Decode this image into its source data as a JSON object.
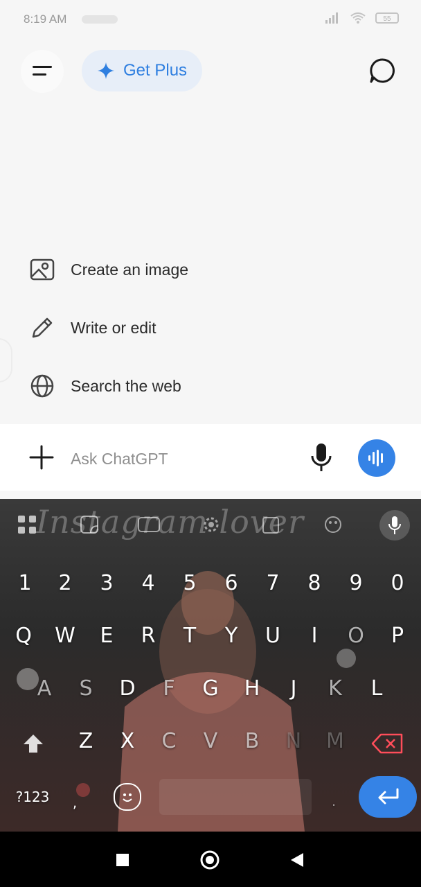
{
  "status_bar": {
    "time": "8:19 AM",
    "battery": "55"
  },
  "header": {
    "get_plus_label": "Get Plus",
    "menu_icon": "menu-icon",
    "new_chat_icon": "new-chat-icon",
    "accent_color": "#2f7fe0"
  },
  "suggestions": [
    {
      "label": "Create an image",
      "icon": "image-icon"
    },
    {
      "label": "Write or edit",
      "icon": "pencil-icon"
    },
    {
      "label": "Search the web",
      "icon": "globe-icon"
    }
  ],
  "composer": {
    "placeholder": "Ask ChatGPT",
    "voice_button_color": "#3583e6"
  },
  "keyboard": {
    "watermark": "Instagram lover",
    "number_row": [
      "1",
      "2",
      "3",
      "4",
      "5",
      "6",
      "7",
      "8",
      "9",
      "0"
    ],
    "row1": [
      "Q",
      "W",
      "E",
      "R",
      "T",
      "Y",
      "U",
      "I",
      "O",
      "P"
    ],
    "row2": [
      "A",
      "S",
      "D",
      "F",
      "G",
      "H",
      "J",
      "K",
      "L"
    ],
    "row3": [
      "Z",
      "X",
      "C",
      "V",
      "B",
      "N",
      "M"
    ],
    "symbols_key": "?123",
    "comma_key": ",",
    "period_key": "."
  }
}
